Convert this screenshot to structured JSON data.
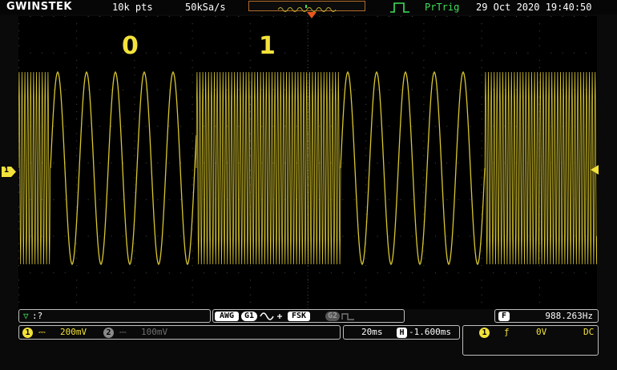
{
  "header": {
    "brand": "GWINSTEK",
    "record_length": "10k pts",
    "sample_rate": "50kSa/s",
    "trigger_status": "PrTrig",
    "datetime": "29 Oct 2020 19:40:50"
  },
  "screen": {
    "annotations": [
      "0",
      "1"
    ],
    "channel_marker": "1"
  },
  "status_bar": {
    "trigger_flag": "▽",
    "trigger_text": ":?",
    "awg_label": "AWG",
    "generator1": "G1",
    "modulation": "FSK",
    "generator2": "G2",
    "freq_badge": "F",
    "frequency": "988.263Hz"
  },
  "channels": {
    "ch1_num": "1",
    "ch1_scale": "200mV",
    "ch2_num": "2",
    "ch2_scale": "100mV"
  },
  "timebase": {
    "time_div": "20ms",
    "h_badge": "H",
    "position": "-1.600ms"
  },
  "trigger": {
    "source": "1",
    "slope": "ƒ",
    "level": "0V",
    "coupling": "DC"
  },
  "colors": {
    "trace": "#d8c62e",
    "ch1": "#f2e23a",
    "accent_green": "#3ee05a",
    "trigger_orange": "#e8571e"
  },
  "icons": {
    "trigger_mode": "pulse-step-icon",
    "trigger_marker": "trigger-position-triangle-icon",
    "sine": "sine-wave-icon",
    "square": "square-wave-icon"
  },
  "signal": {
    "modulation": "FSK",
    "bits": [
      0,
      1,
      0,
      1
    ]
  }
}
